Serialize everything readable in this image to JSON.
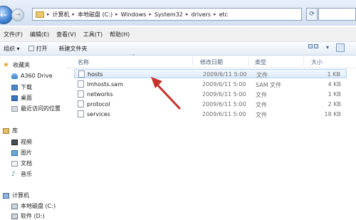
{
  "address_bar": {
    "breadcrumbs": [
      "计算机",
      "本地磁盘 (C:)",
      "Windows",
      "System32",
      "drivers",
      "etc"
    ]
  },
  "menu": [
    "文件(F)",
    "编辑(E)",
    "查看(V)",
    "工具(T)",
    "帮助(H)"
  ],
  "toolbar": {
    "organize": "组织 ▾",
    "open": "打开",
    "new_folder": "新建文件夹"
  },
  "nav": {
    "favorites": "收藏夹",
    "fav_items": [
      "A360 Drive",
      "下载",
      "桌面",
      "最近访问的位置"
    ],
    "libraries": "库",
    "lib_items": [
      "视频",
      "图片",
      "文档",
      "音乐"
    ],
    "computer": "计算机",
    "drives": [
      "本地磁盘 (C:)",
      "软件 (D:)"
    ]
  },
  "columns": {
    "name": "名称",
    "date": "修改日期",
    "type": "类型",
    "size": "大小"
  },
  "files": [
    {
      "name": "hosts",
      "date": "2009/6/11 5:00",
      "type": "文件",
      "size": "1 KB"
    },
    {
      "name": "lmhosts.sam",
      "date": "2009/6/11 5:00",
      "type": "SAM 文件",
      "size": "4 KB"
    },
    {
      "name": "networks",
      "date": "2009/6/11 5:00",
      "type": "文件",
      "size": "1 KB"
    },
    {
      "name": "protocol",
      "date": "2009/6/11 5:00",
      "type": "文件",
      "size": "2 KB"
    },
    {
      "name": "services",
      "date": "2009/6/11 5:00",
      "type": "文件",
      "size": "18 KB"
    }
  ],
  "colors": {
    "annotation_arrow": "#c8322c",
    "selection": "#dceafb"
  }
}
